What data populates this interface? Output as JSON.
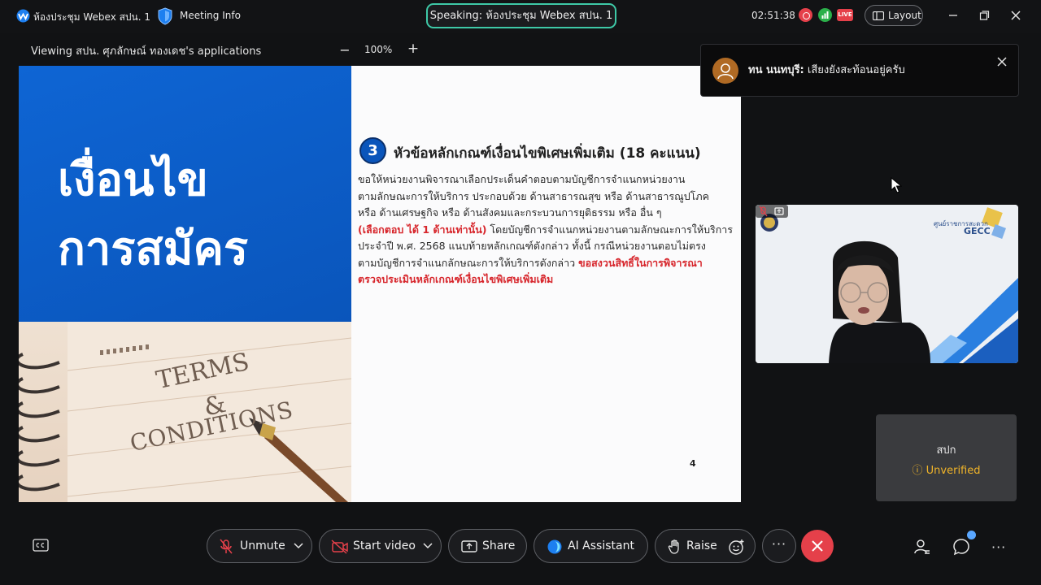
{
  "window": {
    "app_title": "ห้องประชุม Webex สปน. 1",
    "meeting_info_label": "Meeting Info",
    "speaking_label": "Speaking: ห้องประชุม Webex สปน. 1",
    "timer": "02:51:38",
    "live_badge": "LIVE",
    "layout_label": "Layout"
  },
  "share_bar": {
    "viewing_label": "Viewing สปน. ศุภลักษณ์ ทองเดช's applications",
    "zoom_out": "−",
    "zoom_value": "100%",
    "zoom_in": "+"
  },
  "slide": {
    "title_line1": "เงื่อนไข",
    "title_line2": "การสมัคร",
    "terms_word": "TERMS",
    "amp_word": "&",
    "conditions_word": "CONDITIONS",
    "number": "3",
    "heading": "หัวข้อหลักเกณฑ์เงื่อนไขพิเศษเพิ่มเติม (18 คะแนน)",
    "body_line1": "ขอให้หน่วยงานพิจารณาเลือกประเด็นคำตอบตามบัญชีการจำแนกหน่วยงาน",
    "body_line2": "ตามลักษณะการให้บริการ ประกอบด้วย ด้านสาธารณสุข หรือ ด้านสาธารณูปโภค",
    "body_line3": "หรือ ด้านเศรษฐกิจ หรือ ด้านสังคมและกระบวนการยุติธรรม หรือ อื่น ๆ",
    "body_line4_red": "(เลือกตอบ ได้ 1 ด้านเท่านั้น)",
    "body_line4_rest": " โดยบัญชีการจำแนกหน่วยงานตามลักษณะการให้บริการ",
    "body_line5": "ประจำปี พ.ศ. 2568 แนบท้ายหลักเกณฑ์ดังกล่าว ทั้งนี้ กรณีหน่วยงานตอบไม่ตรง",
    "body_line6_start": "ตามบัญชีการจำแนกลักษณะการให้บริการดังกล่าว ",
    "body_line6_red": "ขอสงวนสิทธิ์ในการพิจารณา",
    "body_line7_red": "ตรวจประเมินหลักเกณฑ์เงื่อนไขพิเศษเพิ่มเติม",
    "page_number": "4"
  },
  "notification": {
    "sender": "ทน นนทบุรี:",
    "message": " เสียงยังสะท้อนอยู่ครับ"
  },
  "video_tile": {
    "org_thai": "ศูนย์ราชการสะดวก",
    "org_abbr": "GECC"
  },
  "unverified_tile": {
    "name": "สปก",
    "status": "Unverified"
  },
  "controls": {
    "unmute_label": "Unmute",
    "start_video_label": "Start video",
    "share_label": "Share",
    "ai_assistant_label": "AI Assistant",
    "raise_label": "Raise",
    "more_label": "···",
    "overflow_label": "···"
  },
  "colors": {
    "accent_speaking": "#3ec9a7",
    "end_call": "#e5404a",
    "unverified": "#f0b429",
    "slide_blue": "#0a55bb",
    "slide_red": "#d7262c"
  },
  "icons": [
    "webex-logo-icon",
    "shield-icon",
    "record-icon",
    "network-icon",
    "layout-icon",
    "minimize-icon",
    "maximize-icon",
    "close-icon",
    "closed-captions-icon",
    "mic-muted-icon",
    "chevron-down-icon",
    "video-off-icon",
    "share-icon",
    "ai-assistant-icon",
    "raise-hand-icon",
    "reaction-icon",
    "end-call-icon",
    "participants-icon",
    "chat-icon"
  ]
}
